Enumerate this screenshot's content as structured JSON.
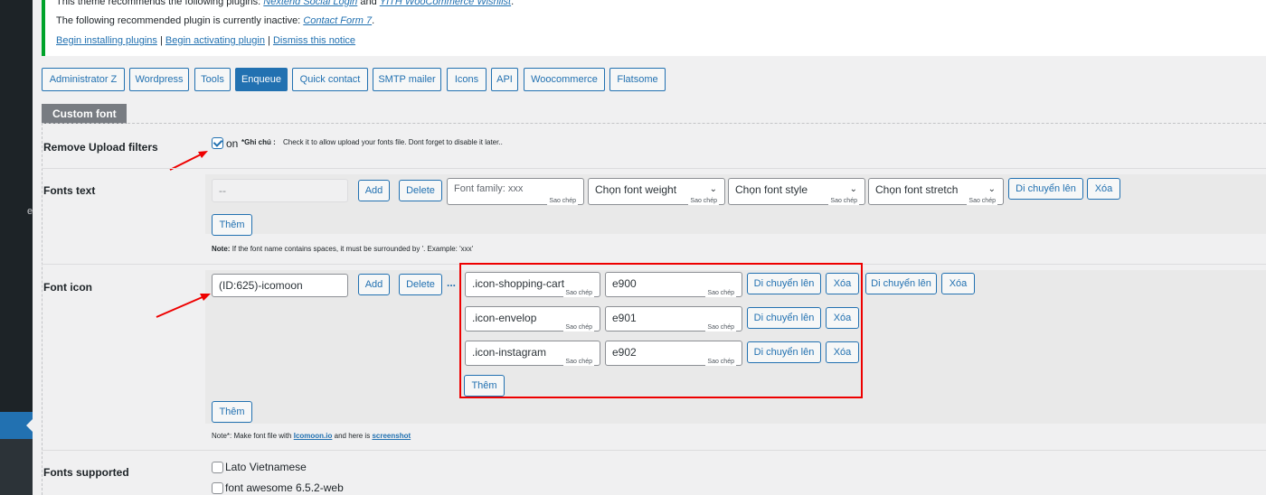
{
  "notice": {
    "line1_prefix": "This theme recommends the following plugins:",
    "line1_link1": "Nextend Social Login",
    "line1_and": "and",
    "line1_link2": "YITH WooCommerce Wishlist",
    "line2_prefix": "The following recommended plugin is currently inactive:",
    "line2_link": "Contact Form 7",
    "link_install": "Begin installing plugins",
    "link_activate": "Begin activating plugin",
    "link_dismiss": "Dismiss this notice",
    "separator": "|"
  },
  "tabs": [
    {
      "label": "Administrator Z"
    },
    {
      "label": "Wordpress"
    },
    {
      "label": "Tools"
    },
    {
      "label": "Enqueue"
    },
    {
      "label": "Quick contact"
    },
    {
      "label": "SMTP mailer"
    },
    {
      "label": "Icons"
    },
    {
      "label": "API"
    },
    {
      "label": "Woocommerce"
    },
    {
      "label": "Flatsome"
    }
  ],
  "section_title": "Custom font",
  "remove_upload": {
    "label": "Remove Upload filters",
    "on": "on",
    "note_bold": "*Ghi chú :",
    "note_text": "Check it to allow upload your fonts file. Dont forget to disable it later.."
  },
  "fonts_text": {
    "label": "Fonts text",
    "input_value": "--",
    "add": "Add",
    "delete": "Delete",
    "font_family_placeholder": "Font family: xxx",
    "copy": "Sao chép",
    "weight": "Chọn font weight",
    "style": "Chọn font style",
    "stretch": "Chọn font stretch",
    "move_up": "Di chuyển lên",
    "remove": "Xóa",
    "more": "Thêm",
    "note_bold": "Note:",
    "note_text": "If the font name contains spaces, it must be surrounded by '. Example: 'xxx'"
  },
  "font_icon": {
    "label": "Font icon",
    "input_value": "(ID:625)-icomoon",
    "add": "Add",
    "delete": "Delete",
    "dots": "...",
    "rows": [
      {
        "class": ".icon-shopping-cart",
        "code": "e900"
      },
      {
        "class": ".icon-envelop",
        "code": "e901"
      },
      {
        "class": ".icon-instagram",
        "code": "e902"
      }
    ],
    "copy": "Sao chép",
    "move_up": "Di chuyển lên",
    "remove": "Xóa",
    "more": "Thêm",
    "note_prefix": "Note*: Make font file with",
    "note_link1": "Icomoon.io",
    "note_mid": "and here is",
    "note_link2": "screenshot"
  },
  "fonts_supported": {
    "label": "Fonts supported",
    "options": [
      "Lato Vietnamese",
      "font awesome 6.5.2-web"
    ]
  },
  "sidebar_stub": "e",
  "colors": {
    "accent": "#2271b1",
    "notice_border": "#00a32a",
    "highlight": "#ee0000"
  }
}
